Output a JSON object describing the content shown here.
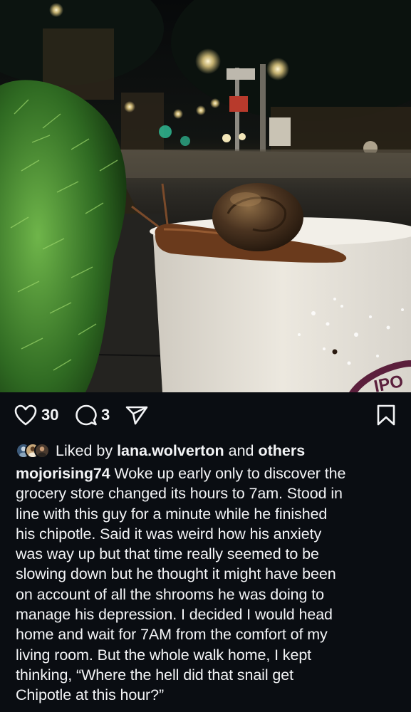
{
  "post": {
    "like_count": "30",
    "comment_count": "3",
    "liked_by": {
      "prefix": "Liked by",
      "user": "lana.wolverton",
      "joiner": "and",
      "others": "others"
    },
    "caption": {
      "username": "mojorising74",
      "lines": [
        "Woke up early only to discover the",
        "grocery store changed its hours to 7am.  Stood in",
        "line with this guy for a minute while he finished",
        "his chipotle.  Said it was weird how his anxiety",
        "was way up but that time really seemed to be",
        "slowing down but he thought it might have been",
        "on account of all the shrooms he was doing to",
        "manage his depression.  I decided I would head",
        "home and wait for 7AM from the comfort of my",
        "living room.  But the whole walk home, I kept",
        "thinking, “Where the hell did that snail get",
        "Chipotle at this hour?”"
      ]
    },
    "cup_logo_text": "IPO"
  },
  "icons": {
    "like": "heart-icon",
    "comment": "comment-bubble-icon",
    "share": "paper-plane-icon",
    "save": "bookmark-icon"
  },
  "colors": {
    "background": "#0a0d12",
    "text": "#f3f4f6",
    "logo": "#5b1f3c"
  }
}
